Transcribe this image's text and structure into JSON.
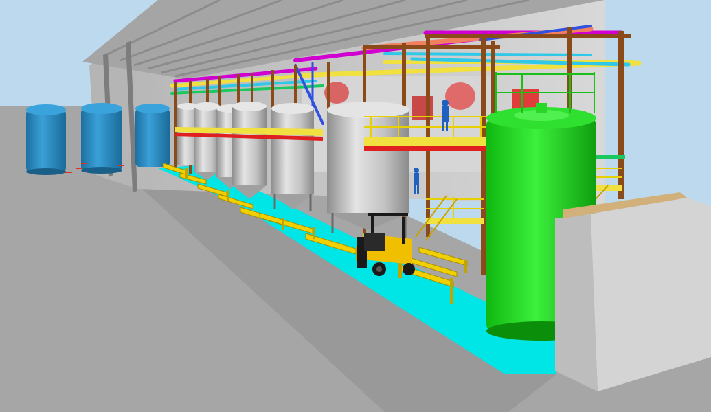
{
  "scene": {
    "kind": "3d-plant-model-render",
    "colors": {
      "sky": "#bcd9ee",
      "ground": "#a3a3a3",
      "floor_highlight": "#00e5e5",
      "building_wall": "#c9c9c9",
      "roof": "#9a9a9a",
      "process_tank": "#c4c4c4",
      "storage_tank_outdoor": "#2f8fc8",
      "large_tank": "#19e619",
      "structural_steel": "#8a4a1a",
      "guard_rail": "#f0d000",
      "pipe_magenta": "#d000d0",
      "pipe_salmon": "#f08060",
      "pipe_yellow": "#f0e040",
      "pipe_cyan": "#30c8e8",
      "pipe_blue": "#3050e0",
      "forklift_body": "#f0c000",
      "forklift_frame": "#1a1a1a",
      "operator": "#2060c0"
    },
    "icons": {
      "outdoor_tanks": "vertical-storage-tank-icon",
      "process_tanks": "conical-bottom-tank-icon",
      "forklift": "forklift-icon",
      "operator": "worker-figure-icon"
    }
  }
}
